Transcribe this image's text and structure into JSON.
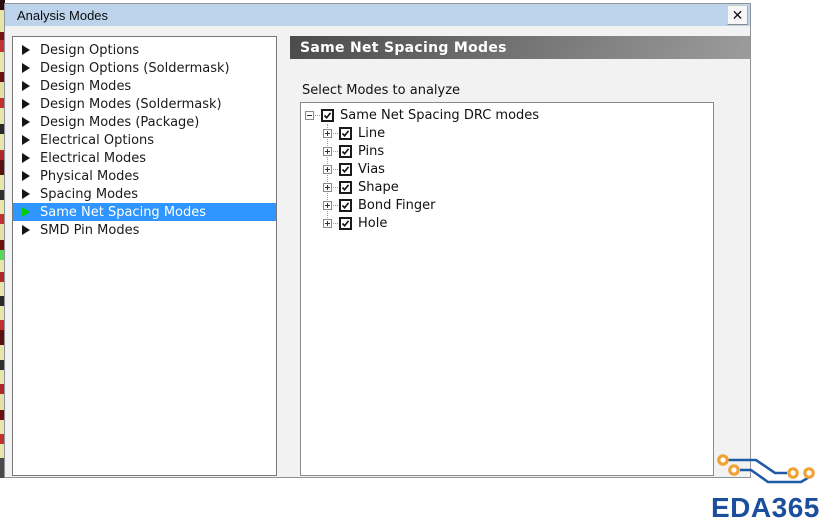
{
  "window": {
    "title": "Analysis Modes",
    "close_icon": "✕"
  },
  "sidebar": {
    "items": [
      {
        "label": "Design Options",
        "selected": false
      },
      {
        "label": "Design Options (Soldermask)",
        "selected": false
      },
      {
        "label": "Design Modes",
        "selected": false
      },
      {
        "label": "Design Modes (Soldermask)",
        "selected": false
      },
      {
        "label": "Design Modes (Package)",
        "selected": false
      },
      {
        "label": "Electrical Options",
        "selected": false
      },
      {
        "label": "Electrical Modes",
        "selected": false
      },
      {
        "label": "Physical Modes",
        "selected": false
      },
      {
        "label": "Spacing Modes",
        "selected": false
      },
      {
        "label": "Same Net Spacing Modes",
        "selected": true
      },
      {
        "label": "SMD Pin Modes",
        "selected": false
      }
    ]
  },
  "panel": {
    "title": "Same Net Spacing Modes",
    "select_label": "Select Modes to analyze"
  },
  "tree": {
    "root": {
      "label": "Same Net Spacing DRC modes",
      "checked": true,
      "expanded": true
    },
    "children": [
      {
        "label": "Line",
        "checked": true
      },
      {
        "label": "Pins",
        "checked": true
      },
      {
        "label": "Vias",
        "checked": true
      },
      {
        "label": "Shape",
        "checked": true
      },
      {
        "label": "Bond Finger",
        "checked": true
      },
      {
        "label": "Hole",
        "checked": true
      }
    ]
  },
  "logo": {
    "text": "EDA365"
  },
  "colors": {
    "titlebar": "#bdd3ec",
    "selection": "#2f96ff",
    "selected_arrow": "#00cf00",
    "header_dark": "#4b4b4b",
    "header_light": "#9c9c9c",
    "logo_blue": "#1b4f9e",
    "logo_orange": "#f0a234",
    "trace_blue": "#1e5ba6"
  }
}
